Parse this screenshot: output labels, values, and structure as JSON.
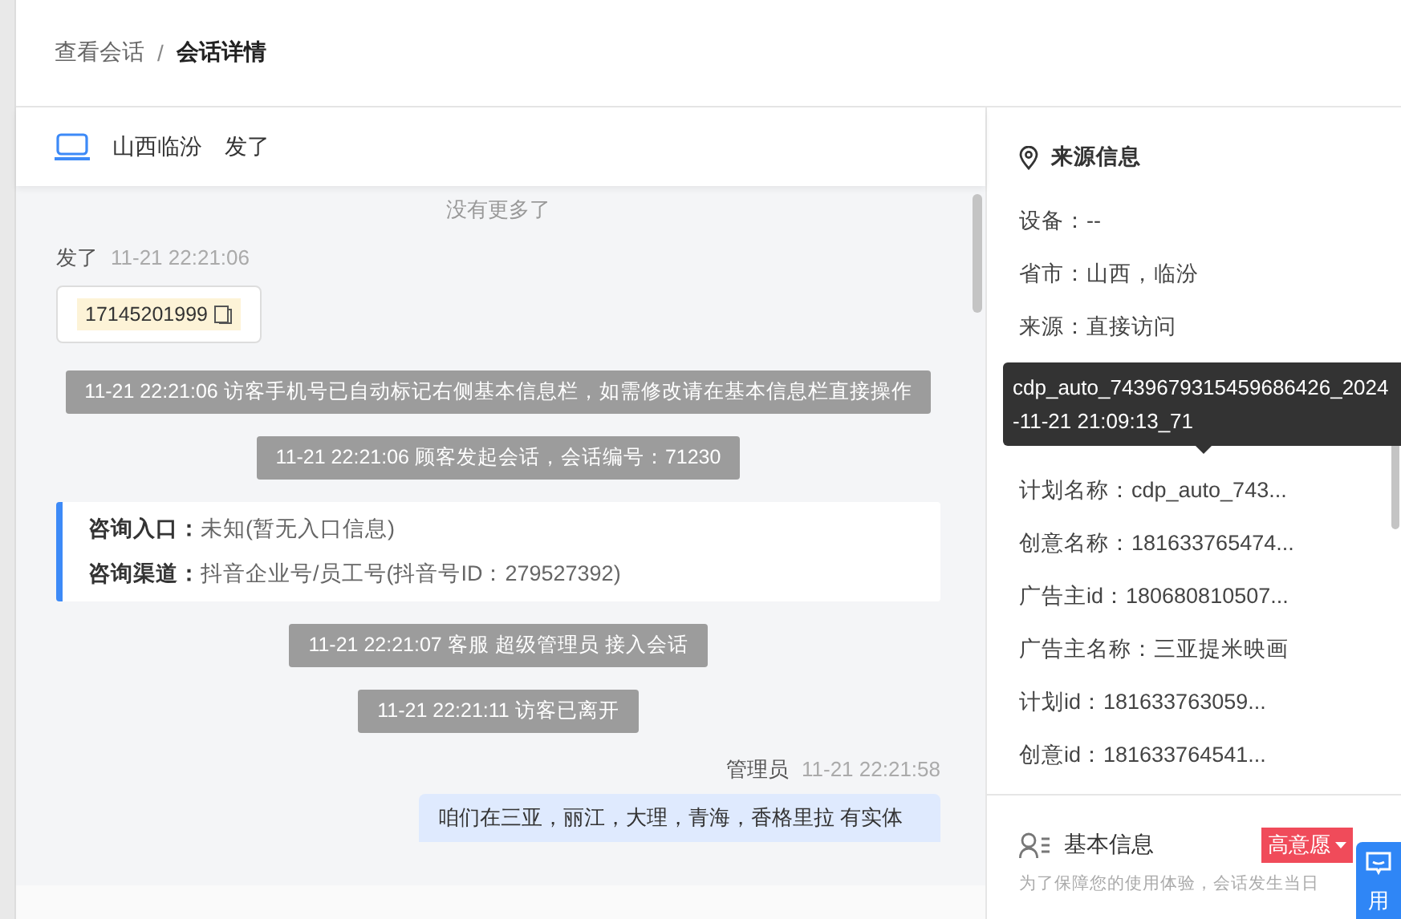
{
  "breadcrumb": [
    {
      "label": "查看会话",
      "current": false
    },
    {
      "label": "会话详情",
      "current": true
    }
  ],
  "breadcrumb_separator": "/",
  "chat_header": {
    "location": "山西临汾",
    "visitor": "发了"
  },
  "messages": [
    {
      "kind": "end_notice",
      "text": "没有更多了"
    },
    {
      "kind": "visitor",
      "sender": "发了",
      "time": "11-21 22:21:06",
      "phone": "17145201999"
    },
    {
      "kind": "system",
      "text": "11-21 22:21:06 访客手机号已自动标记右侧基本信息栏，如需修改请在基本信息栏直接操作"
    },
    {
      "kind": "system",
      "text": "11-21 22:21:06 顾客发起会话，会话编号：71230"
    },
    {
      "kind": "info_card",
      "lines": [
        {
          "label": "咨询入口：",
          "value": "未知(暂无入口信息)"
        },
        {
          "label": "咨询渠道：",
          "value": "抖音企业号/员工号(抖音号ID：279527392)"
        }
      ]
    },
    {
      "kind": "system",
      "text": "11-21 22:21:07 客服 超级管理员 接入会话"
    },
    {
      "kind": "system",
      "text": "11-21 22:21:11 访客已离开"
    },
    {
      "kind": "agent",
      "sender": "管理员",
      "time": "11-21 22:21:58",
      "text": "咱们在三亚，丽江，大理，青海，香格里拉 有实体"
    }
  ],
  "source_info": {
    "title": "来源信息",
    "fields": [
      "设备：--",
      "省市：山西，临汾",
      "来源：直接访问"
    ],
    "tooltip": "cdp_auto_7439679315459686426_2024-11-21 21:09:13_71",
    "ad_fields": [
      "计划名称：cdp_auto_743...",
      "创意名称：181633765474...",
      "广告主id：180680810507...",
      "广告主名称：三亚提米映画",
      "计划id：181633763059...",
      "创意id：181633764541..."
    ]
  },
  "basic_info": {
    "title": "基本信息",
    "tag": "高意愿",
    "hint": "为了保障您的使用体验，会话发生当日"
  },
  "float_button": {
    "label": "用"
  }
}
